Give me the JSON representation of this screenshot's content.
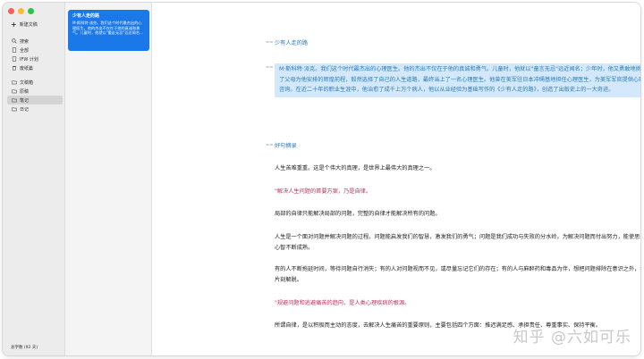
{
  "sidebar": {
    "new_doc_label": "新建文稿",
    "items": [
      {
        "label": "搜索",
        "icon": "search-icon"
      },
      {
        "label": "全部",
        "icon": "document-icon"
      },
      {
        "label": "IFW 计划",
        "icon": "document-icon"
      },
      {
        "label": "废纸篓",
        "icon": "trash-icon"
      }
    ],
    "folders": [
      {
        "label": "文稿箱",
        "icon": "folder-icon"
      },
      {
        "label": "原稿",
        "icon": "folder-icon"
      },
      {
        "label": "笔记",
        "icon": "folder-icon",
        "active": true
      },
      {
        "label": "日记",
        "icon": "folder-icon"
      }
    ],
    "word_count": "总字数 (92 天)"
  },
  "list": {
    "card_title": "少有人走的路",
    "card_text": "M·斯科特·派克。我们这个时代最杰出的心理医生。他的杰出不仅在于他的真诚和勇气。儿童时，他就以\"重走无忌\"远近闻名..."
  },
  "editor": {
    "title": "少有人走的路",
    "intro": "M·斯科特·派克。我们这个时代最杰出的心理医生。他的杰出不仅在于他的真诚和勇气。儿童时，他就以\"童言无忌\"远近闻名；少年时，他又勇敢地挑战了父母为他安排的辉煌前程，毅然选择了自己的人生道路，最终当上了一名心理医生。他曾在美军驻日本冲绳基地担任心理医生，为美军军官提供心理咨询。在近二十年的职业生涯中，他治愈了成千上万个病人，他以从业经验为基础写作的《少有人走的路》，创造了出版史上的一大奇迹。",
    "section": "好句摘录",
    "p1": "人生苦难重重。这是个伟大的真理，是世界上最伟大的真理之一。",
    "q1": "\"解决人生问题的首要方案，乃是自律。",
    "p2": "局部的自律只能解决局部的问题，完整的自律才能解决所有的问题。",
    "p3": "人生是一个面对问题并解决问题的过程。问题能启发我们的智慧，激发我们的勇气；问题是我们成功与失败的分水岭。为解决问题而付出努力，能使思想和心智不断成熟。",
    "p4": "有的人不断拖延时间，等待问题自行消失；有的人对问题视而不见，或尽量忘记它们的存在；有的人与麻醉药和毒品为伴，想把问题排除在意识之外，换得片刻解脱。",
    "q2": "\"规避问题和逃避痛苦的趋向，是人类心理疾病的根源。",
    "p5": "所谓自律，是以积极而主动的态度，去解决人生痛苦的重要原则，主要包括四个方面：推迟满足感、承担责任、尊重事实、保持平衡。"
  },
  "watermark": "知乎 @六如可乐"
}
